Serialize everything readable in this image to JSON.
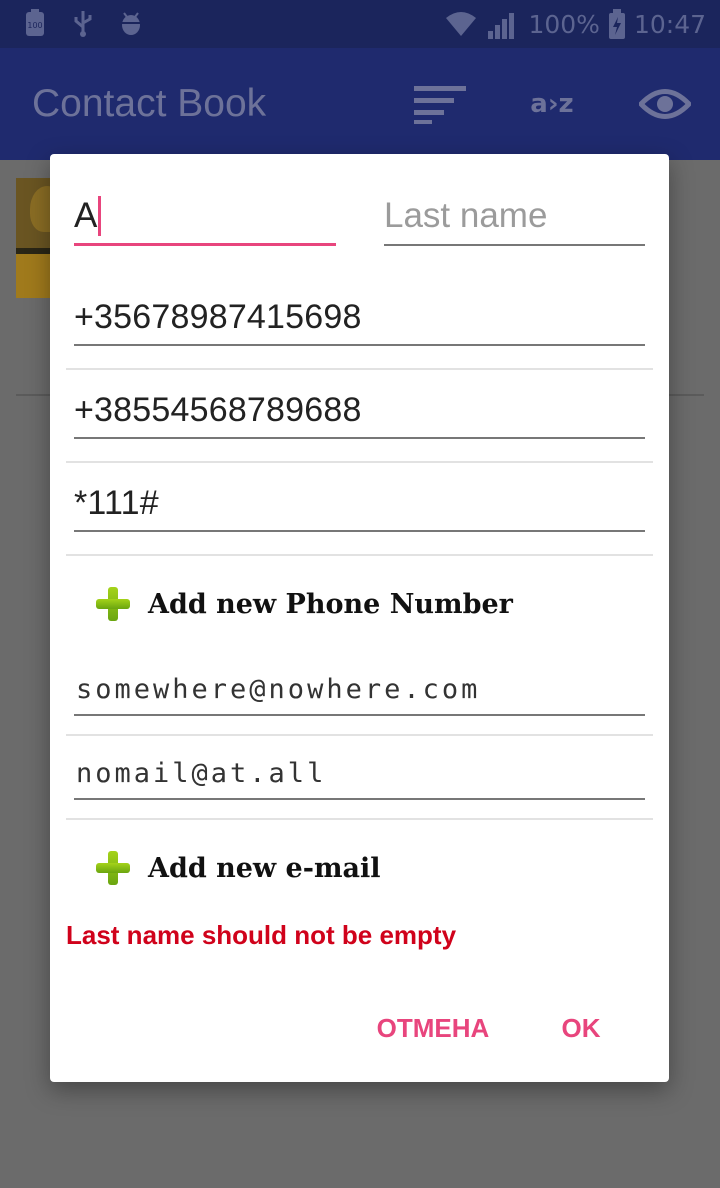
{
  "status_bar": {
    "left_icons": [
      "battery-100-icon",
      "usb-icon",
      "android-debug-icon"
    ],
    "battery_percent": "100%",
    "time": "10:47",
    "badge_text": "100"
  },
  "app_bar": {
    "title": "Contact Book",
    "az_label": "a›z"
  },
  "dialog": {
    "first_name_value": "A",
    "last_name_placeholder": "Last name",
    "phones": [
      "+35678987415698",
      "+38554568789688",
      "*111#"
    ],
    "add_phone_label": "Add new Phone Number",
    "emails": [
      "somewhere@nowhere.com",
      "nomail@at.all"
    ],
    "add_email_label": "Add new e-mail",
    "error_message": "Last name should not be empty",
    "cancel_label": "ОТМЕНА",
    "ok_label": "OK"
  },
  "colors": {
    "status_bar": "#1b255c",
    "app_bar": "#1f2a6e",
    "accent": "#e8457d",
    "error": "#d0021b",
    "add_icon": "#8cc21a"
  }
}
